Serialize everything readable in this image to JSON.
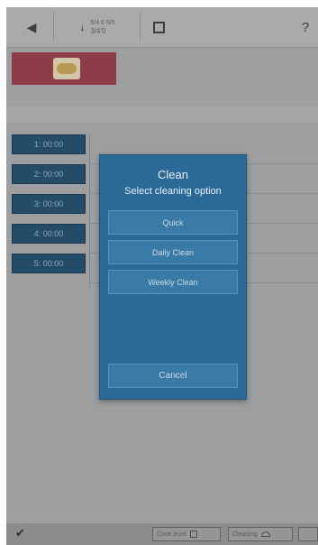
{
  "toolbar": {
    "back_icon": "back-arrow-icon",
    "temp_small": "5/4 6 5/5",
    "temp_value": "3/4'0",
    "square_icon": "square-icon",
    "help_label": "?"
  },
  "product": {
    "image_icon": "bread-icon",
    "color": "#8e3b48"
  },
  "timers": [
    {
      "label": "1: 00:00"
    },
    {
      "label": "2: 00:00"
    },
    {
      "label": "3: 00:00"
    },
    {
      "label": "4: 00:00"
    },
    {
      "label": "5: 00:00"
    }
  ],
  "dialog": {
    "title": "Clean",
    "subtitle": "Select cleaning option",
    "options": [
      {
        "label": "Quick"
      },
      {
        "label": "Daily Clean"
      },
      {
        "label": "Weekly Clean"
      }
    ],
    "cancel_label": "Cancel",
    "accent": "#2b6a97"
  },
  "bottombar": {
    "check_icon": "check-icon",
    "buttons": [
      {
        "label": "Cook level"
      },
      {
        "label": "Cleaning"
      }
    ]
  }
}
